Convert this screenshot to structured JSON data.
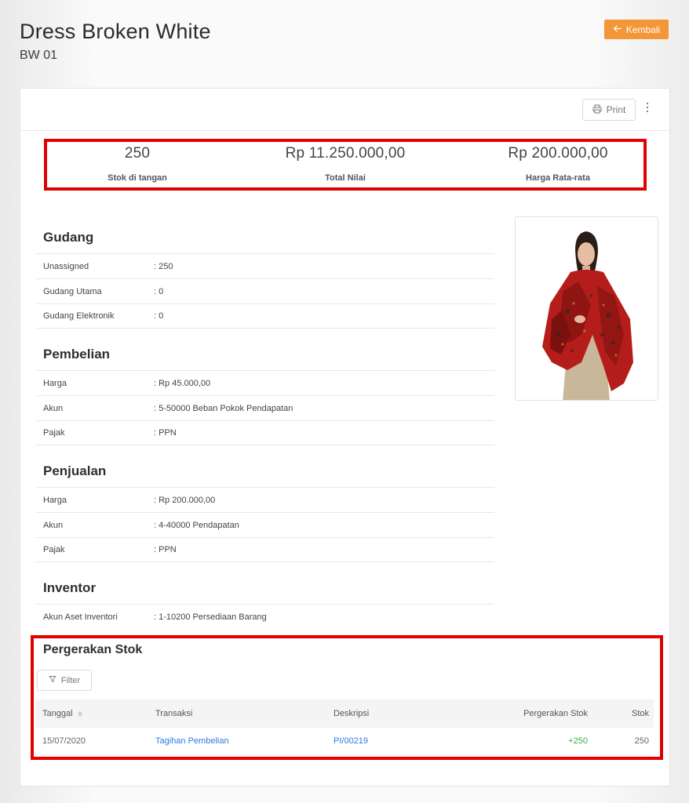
{
  "header": {
    "title": "Dress Broken White",
    "subtitle": "BW 01",
    "back_label": "Kembali"
  },
  "toolbar": {
    "print_label": "Print"
  },
  "stats": [
    {
      "value": "250",
      "label": "Stok di tangan"
    },
    {
      "value": "Rp 11.250.000,00",
      "label": "Total Nilai"
    },
    {
      "value": "Rp 200.000,00",
      "label": "Harga Rata-rata"
    }
  ],
  "sections": {
    "gudang": {
      "title": "Gudang",
      "rows": [
        {
          "label": "Unassigned",
          "value": ": 250"
        },
        {
          "label": "Gudang Utama",
          "value": ": 0"
        },
        {
          "label": "Gudang Elektronik",
          "value": ": 0"
        }
      ]
    },
    "pembelian": {
      "title": "Pembelian",
      "rows": [
        {
          "label": "Harga",
          "value": ": Rp 45.000,00"
        },
        {
          "label": "Akun",
          "value": ": 5-50000 Beban Pokok Pendapatan"
        },
        {
          "label": "Pajak",
          "value": ": PPN"
        }
      ]
    },
    "penjualan": {
      "title": "Penjualan",
      "rows": [
        {
          "label": "Harga",
          "value": ": Rp 200.000,00"
        },
        {
          "label": "Akun",
          "value": ": 4-40000 Pendapatan"
        },
        {
          "label": "Pajak",
          "value": ": PPN"
        }
      ]
    },
    "inventor": {
      "title": "Inventor",
      "rows": [
        {
          "label": "Akun Aset Inventori",
          "value": ": 1-10200 Persediaan Barang"
        }
      ]
    }
  },
  "stock_movement": {
    "title": "Pergerakan Stok",
    "filter_label": "Filter",
    "columns": [
      "Tanggal",
      "Transaksi",
      "Deskripsi",
      "Pergerakan Stok",
      "Stok"
    ],
    "rows": [
      {
        "tanggal": "15/07/2020",
        "transaksi": "Tagihan Pembelian",
        "deskripsi": "PI/00219",
        "pergerakan": "+250",
        "stok": "250"
      }
    ]
  },
  "colors": {
    "accent": "#f39638",
    "highlight_border": "#e10000",
    "link": "#2c7be5",
    "positive": "#3aa84a"
  },
  "icons": {
    "back": "arrow-left-icon",
    "print": "printer-icon",
    "more": "more-vertical-icon",
    "filter": "filter-icon",
    "sort": "sort-icon"
  }
}
